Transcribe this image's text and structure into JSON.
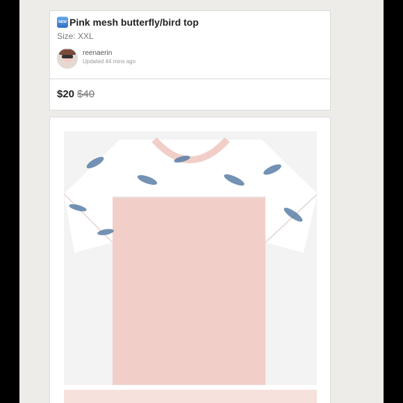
{
  "listing": {
    "badge": "NEW",
    "title": "Pink mesh butterfly/bird top",
    "size_label": "Size: XXL"
  },
  "seller": {
    "username": "reenaerin",
    "updated": "Updated 44 mins ago"
  },
  "pricing": {
    "price": "$20",
    "original_price": "$40"
  },
  "colors": {
    "shirt_pink": "#f1cfc8",
    "mesh_white": "#ffffff",
    "bird_blue": "#5b7fa8"
  },
  "icons": {
    "new_badge": "new-badge-icon"
  }
}
